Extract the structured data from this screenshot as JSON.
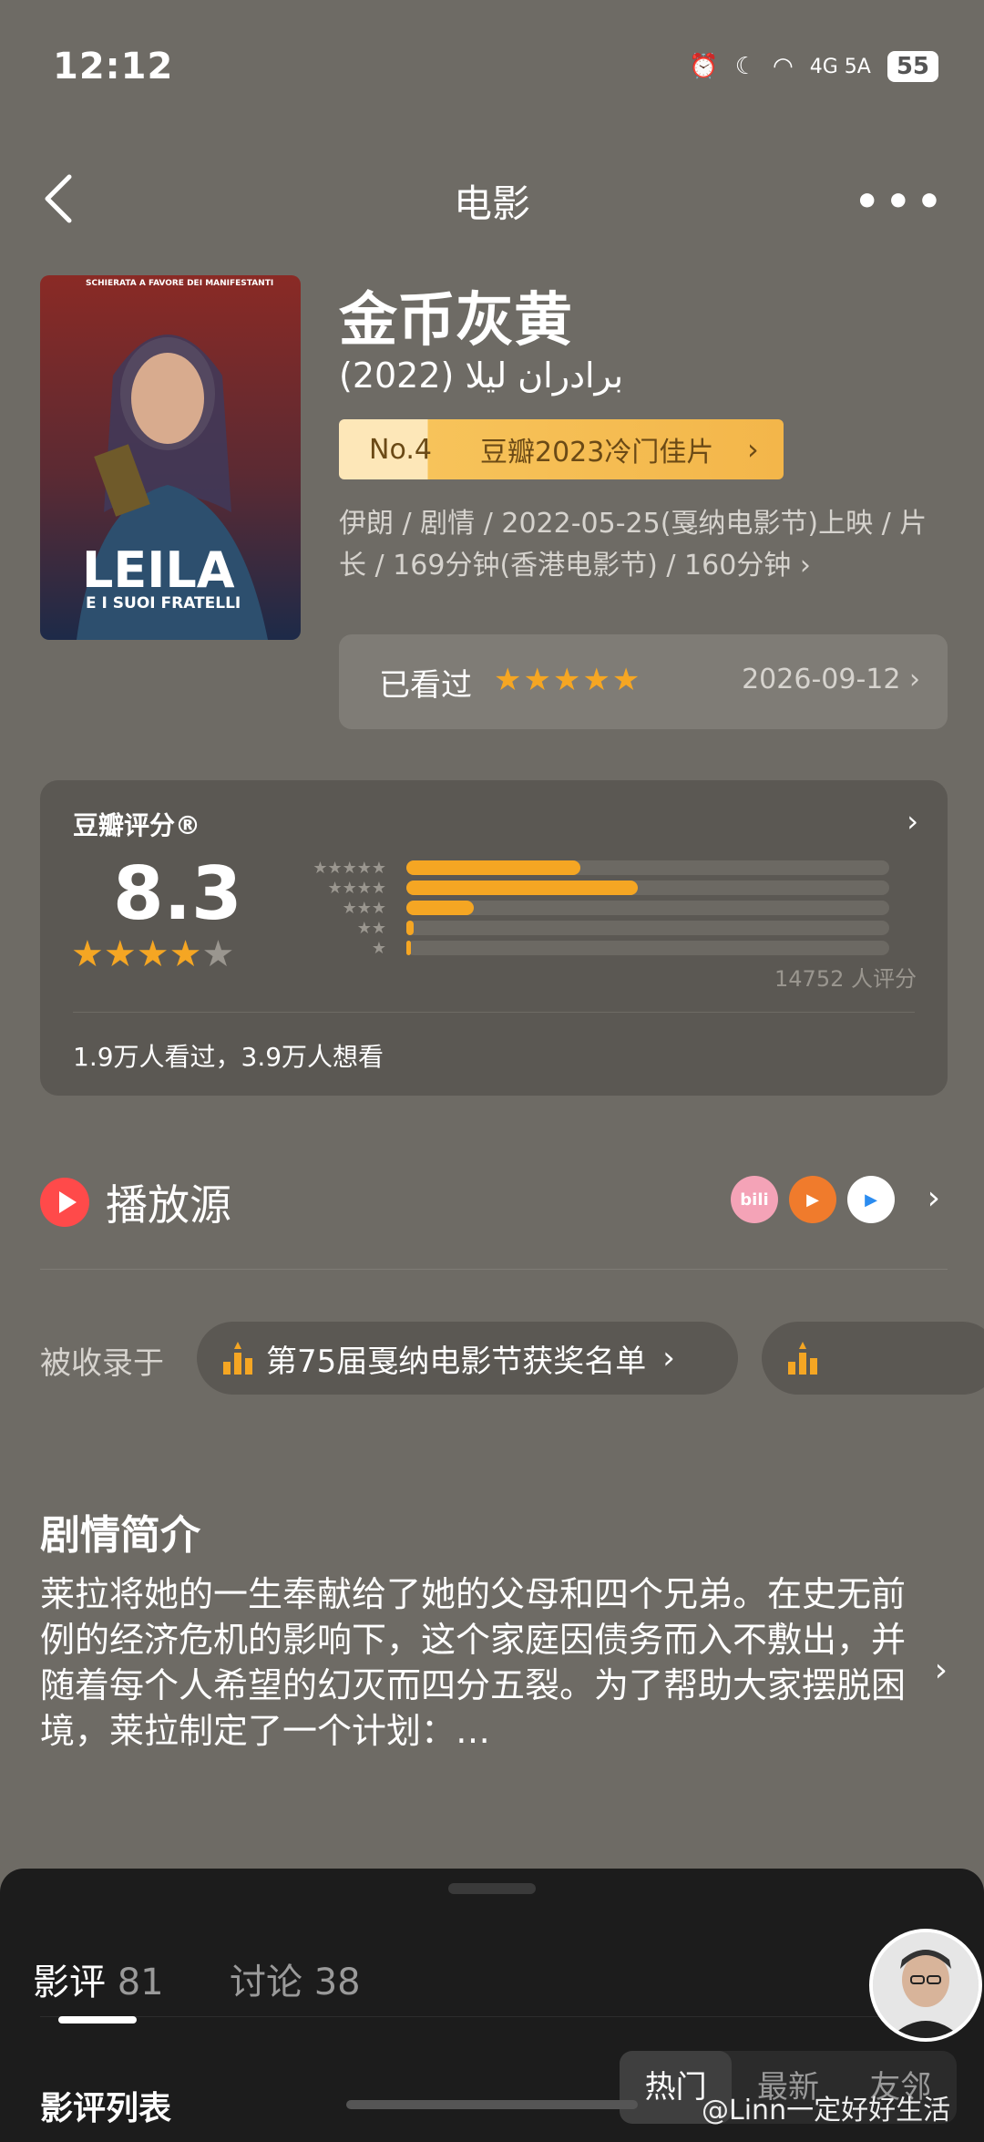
{
  "status_bar": {
    "time": "12:12",
    "network": "4G 5A",
    "battery": "55",
    "signal_label": "7"
  },
  "nav": {
    "title": "电影"
  },
  "movie": {
    "title": "金币灰黄",
    "subtitle": "برادران لیلا (2022)",
    "poster_title": "LEILA",
    "poster_subtitle": "E I SUOI FRATELLI",
    "poster_top_text": "SCHIERATA A FAVORE DEI MANIFESTANTI",
    "rank_no": "No.4",
    "rank_label": "豆瓣2023冷门佳片",
    "meta": "伊朗 / 剧情 / 2022-05-25(戛纳电影节)上映 / 片长 / 169分钟(香港电影节) / 160分钟"
  },
  "watched": {
    "label": "已看过",
    "stars": "★★★★★",
    "date": "2026-09-12"
  },
  "rating": {
    "title": "豆瓣评分®",
    "score": "8.3",
    "stars_full": "★★★★",
    "stars_empty": "★",
    "count": "14752 人评分",
    "footer": "1.9万人看过，3.9万人想看",
    "distribution": [
      {
        "stars": "★★★★★",
        "percent": 36
      },
      {
        "stars": "★★★★",
        "percent": 48
      },
      {
        "stars": "★★★",
        "percent": 14
      },
      {
        "stars": "★★",
        "percent": 1.5
      },
      {
        "stars": "★",
        "percent": 0.5
      }
    ]
  },
  "play": {
    "label": "播放源",
    "sources": [
      "bilibili",
      "xigua",
      "tencent"
    ]
  },
  "collections": {
    "label": "被收录于",
    "items": [
      "第75届戛纳电影节获奖名单",
      ""
    ]
  },
  "synopsis": {
    "title": "剧情简介",
    "text": "莱拉将她的一生奉献给了她的父母和四个兄弟。在史无前例的经济危机的影响下，这个家庭因债务而入不敷出，并随着每个人希望的幻灭而四分五裂。为了帮助大家摆脱困境，莱拉制定了一个计划：…"
  },
  "sheet": {
    "tabs": [
      {
        "label": "影评",
        "count": "81"
      },
      {
        "label": "讨论",
        "count": "38"
      }
    ],
    "list_title": "影评列表",
    "segments": [
      "热门",
      "最新",
      "友邻"
    ]
  },
  "watermark": "@Linn一定好好生活",
  "colors": {
    "background": "#6e6b65",
    "accent": "#f5a623",
    "sheet": "#1c1c1c"
  }
}
